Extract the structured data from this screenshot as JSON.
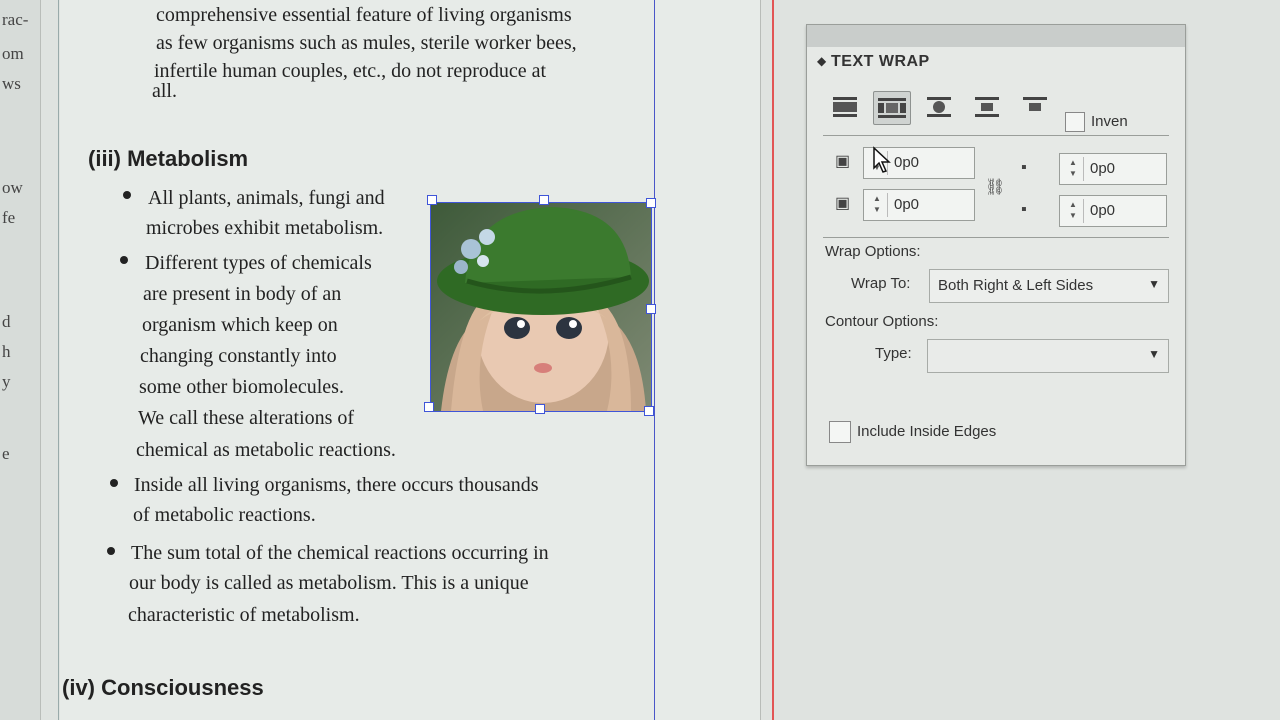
{
  "document": {
    "intro_lines": [
      "comprehensive essential feature of living organisms",
      "as few organisms such as mules, sterile worker bees,",
      "infertile human couples, etc., do not reproduce at",
      "all."
    ],
    "heading_metabolism": "(iii) Metabolism",
    "bullet1_lines": [
      "All plants, animals, fungi and",
      "microbes exhibit metabolism."
    ],
    "bullet2_lines": [
      "Different types of chemicals",
      "are present in body of an",
      "organism which keep on",
      "changing constantly into",
      "some other biomolecules.",
      "We call these alterations of",
      "chemical as metabolic reactions."
    ],
    "bullet3_lines": [
      "Inside all living organisms, there occurs thousands",
      "of metabolic reactions."
    ],
    "bullet4_lines": [
      "The sum total of the chemical reactions occurring in",
      "our body is called as metabolism. This is a unique",
      "characteristic of metabolism."
    ],
    "heading_consciousness": "(iv) Consciousness"
  },
  "left_fragments": [
    "rac-",
    "om",
    "ws",
    "ow",
    "fe",
    "d",
    "h",
    "y",
    "e"
  ],
  "panel": {
    "title": "TEXT WRAP",
    "invert_label": "Inven",
    "invert_checked": false,
    "offsets": {
      "top": "0p0",
      "bottom": "0p0",
      "left": "0p0",
      "right": "0p0"
    },
    "wrap_options_label": "Wrap Options:",
    "wrap_to_label": "Wrap To:",
    "wrap_to_value": "Both Right & Left Sides",
    "contour_options_label": "Contour Options:",
    "type_label": "Type:",
    "type_value": "",
    "include_inside_edges_label": "Include Inside Edges",
    "include_inside_edges_checked": false,
    "active_wrap_mode": "wrap-around-bounding-box",
    "wrap_modes": [
      "no-text-wrap",
      "wrap-around-bounding-box",
      "wrap-around-object-shape",
      "jump-object",
      "jump-to-next-column"
    ]
  },
  "colors": {
    "selection": "#3f55d8",
    "bleed": "#e25555",
    "hat": "#3b7a2e"
  }
}
